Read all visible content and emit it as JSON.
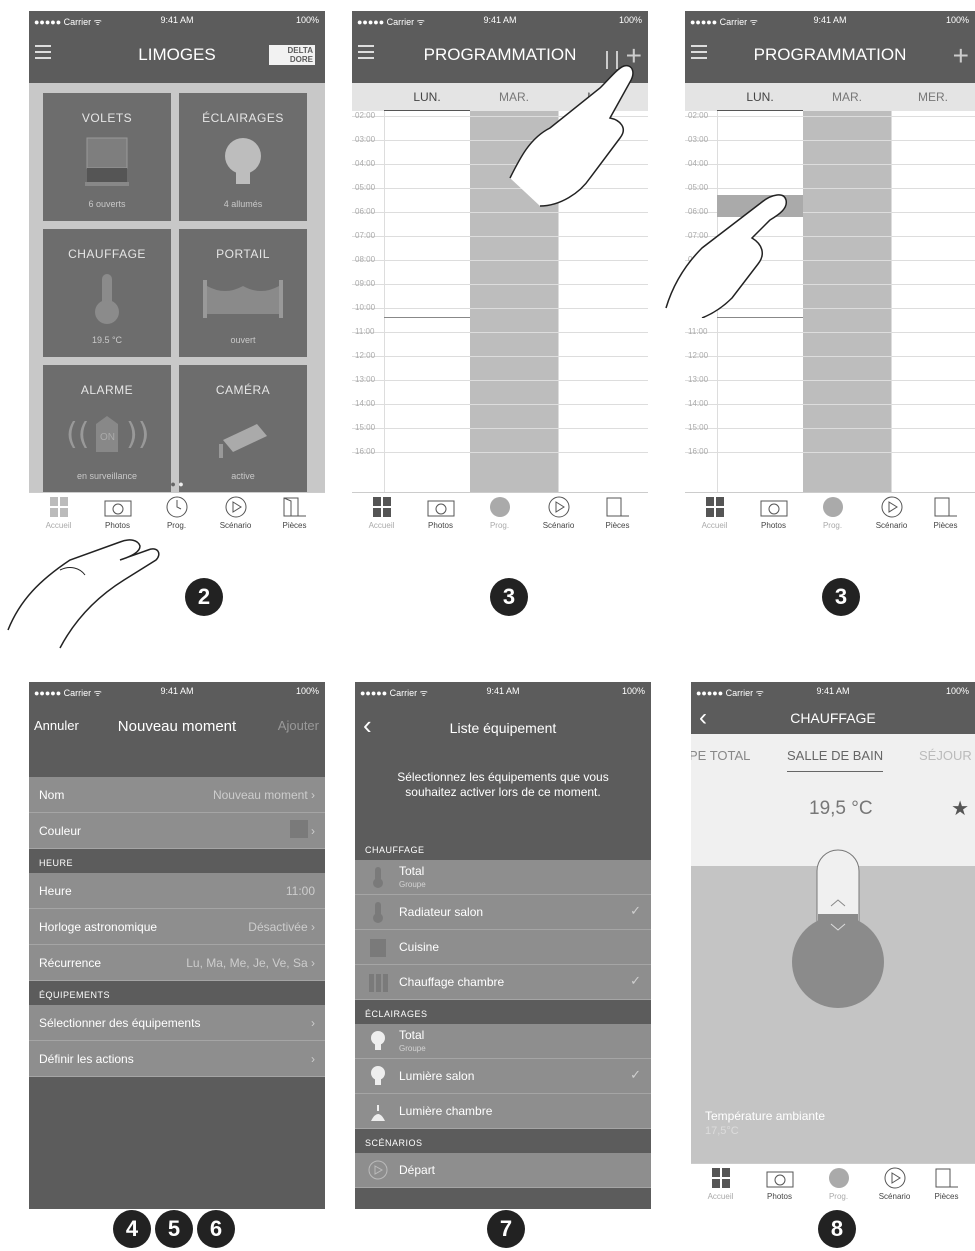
{
  "status": {
    "carrier": "●●●●● Carrier ᯤ",
    "time": "9:41 AM",
    "battery": "100%"
  },
  "screen1": {
    "title": "LIMOGES",
    "brand": "DELTA DORE",
    "tiles": [
      {
        "title": "VOLETS",
        "status": "6 ouverts"
      },
      {
        "title": "ÉCLAIRAGES",
        "status": "4 allumés"
      },
      {
        "title": "CHAUFFAGE",
        "status": "19.5 °C"
      },
      {
        "title": "PORTAIL",
        "status": "ouvert"
      },
      {
        "title": "ALARME",
        "status": "en surveillance",
        "badge": "ON"
      },
      {
        "title": "CAMÉRA",
        "status": "active"
      }
    ],
    "step": "2"
  },
  "tabbar": {
    "accueil": "Accueil",
    "photos": "Photos",
    "prog": "Prog.",
    "scenario": "Scénario",
    "pieces": "Pièces"
  },
  "screen2": {
    "title": "PROGRAMMATION",
    "days": [
      "LUN.",
      "MAR.",
      "MER."
    ],
    "step": "3"
  },
  "screen3": {
    "title": "PROGRAMMATION",
    "days": [
      "LUN.",
      "MAR.",
      "MER."
    ],
    "add_symbol": "+",
    "step": "3"
  },
  "hours": [
    "02:00",
    "03:00",
    "04:00",
    "05:00",
    "06:00",
    "07:00",
    "08:00",
    "09:00",
    "10:00",
    "11:00",
    "12:00",
    "13:00",
    "14:00",
    "15:00",
    "16:00"
  ],
  "screen4": {
    "cancel": "Annuler",
    "title": "Nouveau moment",
    "add": "Ajouter",
    "nom_label": "Nom",
    "nom_value": "Nouveau moment",
    "couleur_label": "Couleur",
    "heure_section": "HEURE",
    "heure_label": "Heure",
    "heure_value": "11:00",
    "horloge_label": "Horloge astronomique",
    "horloge_value": "Désactivée",
    "recurrence_label": "Récurrence",
    "recurrence_value": "Lu, Ma, Me, Je, Ve, Sa",
    "equip_section": "ÉQUIPEMENTS",
    "select_label": "Sélectionner des équipements",
    "actions_label": "Définir les actions",
    "steps": [
      "4",
      "5",
      "6"
    ]
  },
  "screen5": {
    "title": "Liste équipement",
    "intro": "Sélectionnez les équipements que vous souhaitez activer lors de ce moment.",
    "chauffage_section": "CHAUFFAGE",
    "chauffage": [
      {
        "name": "Total",
        "sub": "Groupe",
        "checked": ""
      },
      {
        "name": "Radiateur salon",
        "sub": "",
        "checked": "✓"
      },
      {
        "name": "Cuisine",
        "sub": "",
        "checked": ""
      },
      {
        "name": "Chauffage chambre",
        "sub": "",
        "checked": "✓"
      }
    ],
    "eclairages_section": "ÉCLAIRAGES",
    "eclairages": [
      {
        "name": "Total",
        "sub": "Groupe",
        "checked": ""
      },
      {
        "name": "Lumière salon",
        "sub": "",
        "checked": "✓"
      },
      {
        "name": "Lumière chambre",
        "sub": "",
        "checked": ""
      }
    ],
    "scenarios_section": "SCÉNARIOS",
    "scenario": "Départ",
    "step": "7"
  },
  "screen6": {
    "title": "CHAUFFAGE",
    "tabs": [
      "PE TOTAL",
      "SALLE DE BAIN",
      "SÉJOUR"
    ],
    "temp": "19,5 °C",
    "ambient_label": "Température ambiante",
    "ambient_value": "17,5°C",
    "step": "8"
  }
}
